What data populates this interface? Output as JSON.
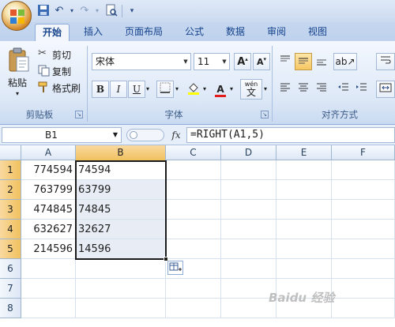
{
  "quick_access": {
    "save_icon": "save-icon",
    "undo_icon": "undo-icon",
    "redo_icon": "redo-icon",
    "preview_icon": "print-preview-icon"
  },
  "tabs": [
    {
      "label": "开始",
      "active": true
    },
    {
      "label": "插入"
    },
    {
      "label": "页面布局"
    },
    {
      "label": "公式"
    },
    {
      "label": "数据"
    },
    {
      "label": "审阅"
    },
    {
      "label": "视图"
    }
  ],
  "clipboard": {
    "paste_label": "粘贴",
    "cut_label": "剪切",
    "copy_label": "复制",
    "format_painter_label": "格式刷",
    "group_label": "剪贴板"
  },
  "font": {
    "font_name": "宋体",
    "font_size": "11",
    "grow_label": "A",
    "shrink_label": "A",
    "bold_label": "B",
    "italic_label": "I",
    "underline_label": "U",
    "font_color_label": "A",
    "phonetic_label": "wén",
    "phonetic_char": "文",
    "group_label": "字体"
  },
  "alignment": {
    "group_label": "对齐方式"
  },
  "formula_bar": {
    "name_box": "B1",
    "fx_label": "fx",
    "formula": "=RIGHT(A1,5)"
  },
  "sheet": {
    "columns": [
      "A",
      "B",
      "C",
      "D",
      "E",
      "F"
    ],
    "selected_column": "B",
    "rows": [
      {
        "num": "1",
        "a": "774594",
        "b": "74594"
      },
      {
        "num": "2",
        "a": "763799",
        "b": "63799"
      },
      {
        "num": "3",
        "a": "474845",
        "b": "74845"
      },
      {
        "num": "4",
        "a": "632627",
        "b": "32627"
      },
      {
        "num": "5",
        "a": "214596",
        "b": "14596"
      },
      {
        "num": "6",
        "a": "",
        "b": ""
      },
      {
        "num": "7",
        "a": "",
        "b": ""
      },
      {
        "num": "8",
        "a": "",
        "b": ""
      }
    ]
  },
  "colors": {
    "accent": "#15428b",
    "selection": "#f1c15f",
    "range_fill": "#e7ecf5"
  },
  "watermark": "Baidu 经验"
}
